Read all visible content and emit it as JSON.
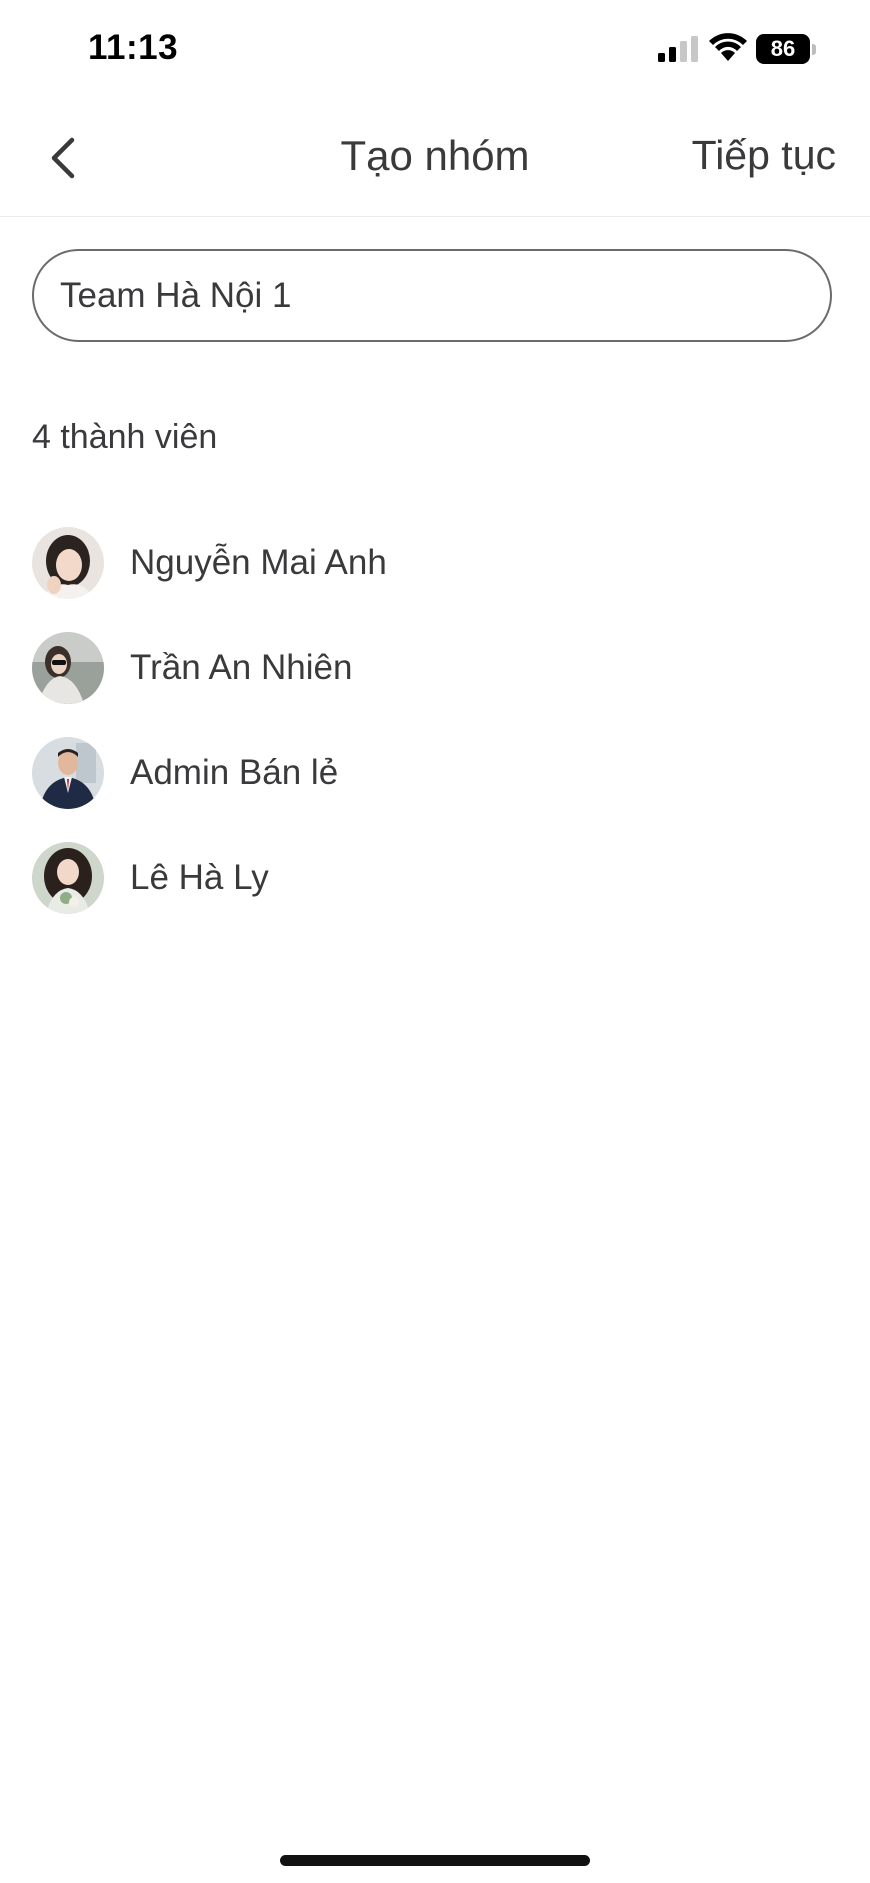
{
  "status_bar": {
    "time": "11:13",
    "battery_level": "86",
    "icons": [
      "signal-icon",
      "wifi-icon",
      "battery-icon"
    ]
  },
  "header": {
    "back_icon": "chevron-left-icon",
    "title": "Tạo nhóm",
    "continue_label": "Tiếp tục"
  },
  "group_name": {
    "value": "Team Hà Nội 1"
  },
  "members": {
    "count_label": "4 thành viên",
    "items": [
      {
        "name": "Nguyễn Mai Anh",
        "avatar": "avatar-photo"
      },
      {
        "name": "Trần An Nhiên",
        "avatar": "avatar-photo"
      },
      {
        "name": "Admin Bán lẻ",
        "avatar": "avatar-photo"
      },
      {
        "name": "Lê Hà Ly",
        "avatar": "avatar-photo"
      }
    ]
  },
  "colors": {
    "text": "#3a3a3c",
    "input_border": "#6b6b6b",
    "divider": "#ececec",
    "background": "#ffffff"
  }
}
